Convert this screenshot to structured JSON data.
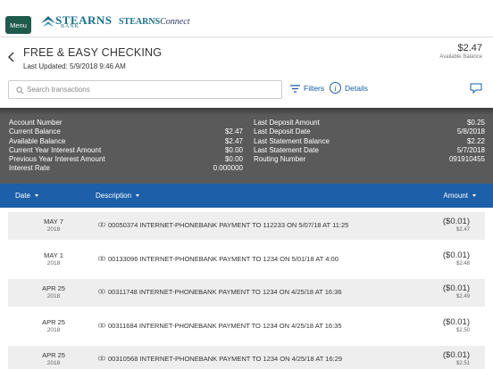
{
  "header": {
    "menu_label": "Menu",
    "logo_text": "STEARNS",
    "logo_sub": "BANK",
    "connect_brand": "STEARNS",
    "connect_suffix": "Connect"
  },
  "account": {
    "title": "FREE & EASY CHECKING",
    "last_updated": "Last Updated: 5/9/2018 9:46 AM",
    "balance": "$2.47",
    "balance_label": "Available Balance"
  },
  "search": {
    "placeholder": "Search transactions",
    "filters_label": "Filters",
    "details_label": "Details"
  },
  "details": {
    "left": [
      {
        "label": "Account Number",
        "value": ""
      },
      {
        "label": "Current Balance",
        "value": "$2.47"
      },
      {
        "label": "Available Balance",
        "value": "$2.47"
      },
      {
        "label": "Current Year Interest Amount",
        "value": "$0.00"
      },
      {
        "label": "Previous Year Interest Amount",
        "value": "$0.00"
      },
      {
        "label": "Interest Rate",
        "value": "0.000000"
      }
    ],
    "right": [
      {
        "label": "Last Deposit Amount",
        "value": "$0.25"
      },
      {
        "label": "Last Deposit Date",
        "value": "5/8/2018"
      },
      {
        "label": "Last Statement Balance",
        "value": "$2.22"
      },
      {
        "label": "Last Statement Date",
        "value": "5/7/2018"
      },
      {
        "label": "Routing Number",
        "value": "091910455"
      }
    ]
  },
  "columns": {
    "date": "Date",
    "description": "Description",
    "amount": "Amount"
  },
  "transactions": [
    {
      "date": "MAY 7",
      "year": "2018",
      "description": "00050374 INTERNET-PHONEBANK PAYMENT TO 112233 ON 5/07/18 AT 11:25",
      "amount": "($0.01)",
      "balance": "$2.47"
    },
    {
      "date": "MAY 1",
      "year": "2018",
      "description": "00133096 INTERNET-PHONEBANK PAYMENT TO 1234 ON 5/01/18 AT 4:00",
      "amount": "($0.01)",
      "balance": "$2.48"
    },
    {
      "date": "APR 25",
      "year": "2018",
      "description": "00311748 INTERNET-PHONEBANK PAYMENT TO 1234 ON 4/25/18 AT 16:36",
      "amount": "($0.01)",
      "balance": "$2.49"
    },
    {
      "date": "APR 25",
      "year": "2018",
      "description": "00311684 INTERNET-PHONEBANK PAYMENT TO 1234 ON 4/25/18 AT 16:35",
      "amount": "($0.01)",
      "balance": "$2.50"
    },
    {
      "date": "APR 25",
      "year": "2018",
      "description": "00310568 INTERNET-PHONEBANK PAYMENT TO 1234 ON 4/25/18 AT 16:29",
      "amount": "($0.01)",
      "balance": "$2.51"
    }
  ],
  "colors": {
    "brand": "#1b6f8c",
    "menu_bg": "#1e5b4b",
    "accent_blue": "#1d5fa8",
    "details_bg": "#5a5a5a"
  },
  "icons": {
    "back": "chevron-left-icon",
    "search": "search-icon",
    "filters": "filter-icon",
    "details": "info-icon",
    "chat": "chat-icon",
    "transaction": "link-icon"
  }
}
